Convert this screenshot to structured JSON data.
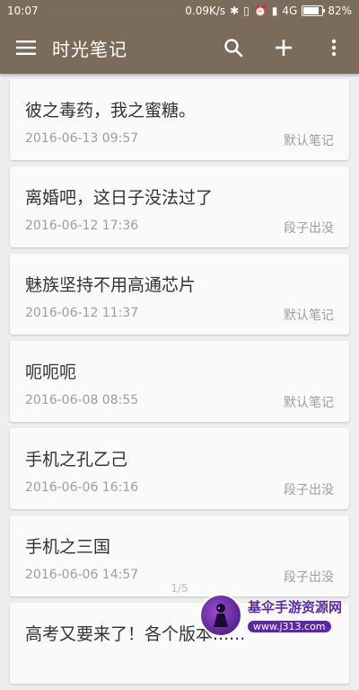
{
  "status": {
    "time": "10:07",
    "speed": "0.09K/s",
    "network": "4G",
    "battery": "82%",
    "battery_level": 0.82
  },
  "appbar": {
    "title": "时光笔记",
    "icons": [
      "menu-icon",
      "search-icon",
      "add-icon",
      "more-vert-icon"
    ]
  },
  "notes": [
    {
      "title": "彼之毒药，我之蜜糖。",
      "date": "2016-06-13 09:57",
      "category": "默认笔记"
    },
    {
      "title": "离婚吧，这日子没法过了",
      "date": "2016-06-12 17:36",
      "category": "段子出没"
    },
    {
      "title": "魅族坚持不用高通芯片",
      "date": "2016-06-12 11:37",
      "category": "默认笔记"
    },
    {
      "title": "呃呃呃",
      "date": "2016-06-08 08:55",
      "category": "默认笔记"
    },
    {
      "title": "手机之孔乙己",
      "date": "2016-06-06 16:16",
      "category": "段子出没"
    },
    {
      "title": "手机之三国",
      "date": "2016-06-06 14:57",
      "category": "段子出没"
    },
    {
      "title": "高考又要来了！各个版本......",
      "date": "",
      "category": ""
    }
  ],
  "pager": "1/5",
  "watermark": {
    "name": "基伞手游资源网",
    "url": "www.j313.com"
  },
  "colors": {
    "appbar": "#7a6b5a",
    "background": "#eeeeee",
    "card": "#fafafa"
  }
}
